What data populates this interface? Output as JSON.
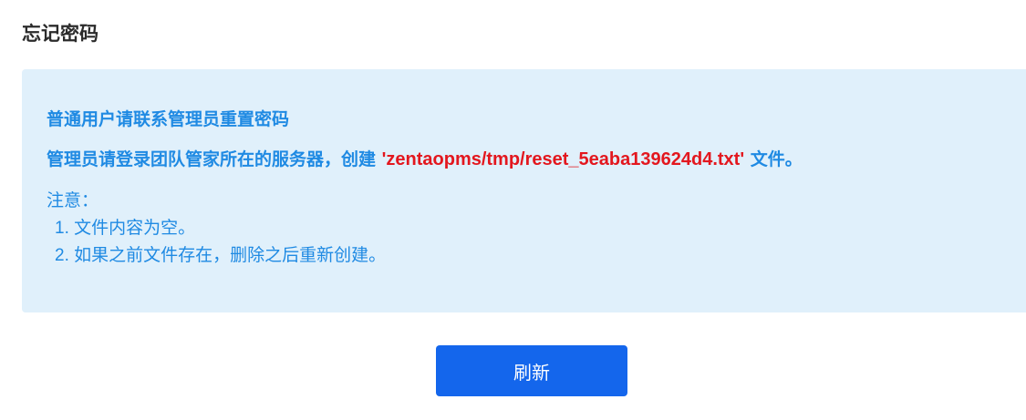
{
  "page": {
    "title": "忘记密码"
  },
  "notice": {
    "line1": "普通用户请联系管理员重置密码",
    "line2_prefix": "管理员请登录团队管家所在的服务器，创建 ",
    "line2_path": "'zentaopms/tmp/reset_5eaba139624d4.txt'",
    "line2_suffix": " 文件。",
    "note_title": "注意：",
    "note_items": [
      "1. 文件内容为空。",
      "2. 如果之前文件存在，删除之后重新创建。"
    ]
  },
  "actions": {
    "refresh_label": "刷新"
  },
  "colors": {
    "notice_bg": "#e0f0fb",
    "notice_text": "#1f8ae3",
    "path_text": "#e3171e",
    "button_bg": "#1466ec"
  }
}
